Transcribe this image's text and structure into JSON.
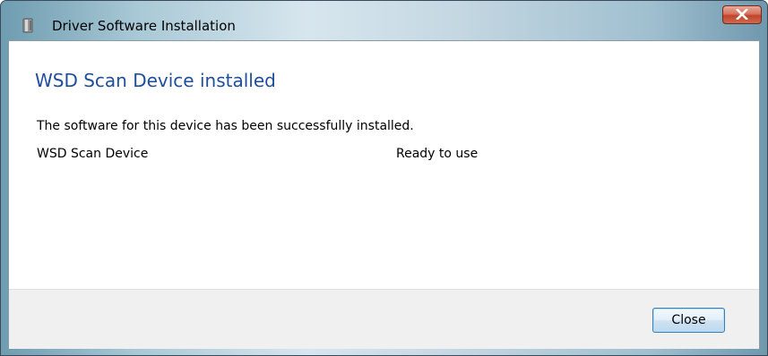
{
  "window": {
    "title": "Driver Software Installation",
    "icon": "device-driver-icon"
  },
  "titlebar": {
    "close_icon": "close-icon",
    "close_color": "#c0442b"
  },
  "content": {
    "heading": "WSD Scan Device installed",
    "heading_color": "#1f4e9c",
    "message": "The software for this device has been successfully installed.",
    "devices": [
      {
        "name": "WSD Scan Device",
        "status": "Ready to use"
      }
    ]
  },
  "footer": {
    "close_label": "Close"
  }
}
